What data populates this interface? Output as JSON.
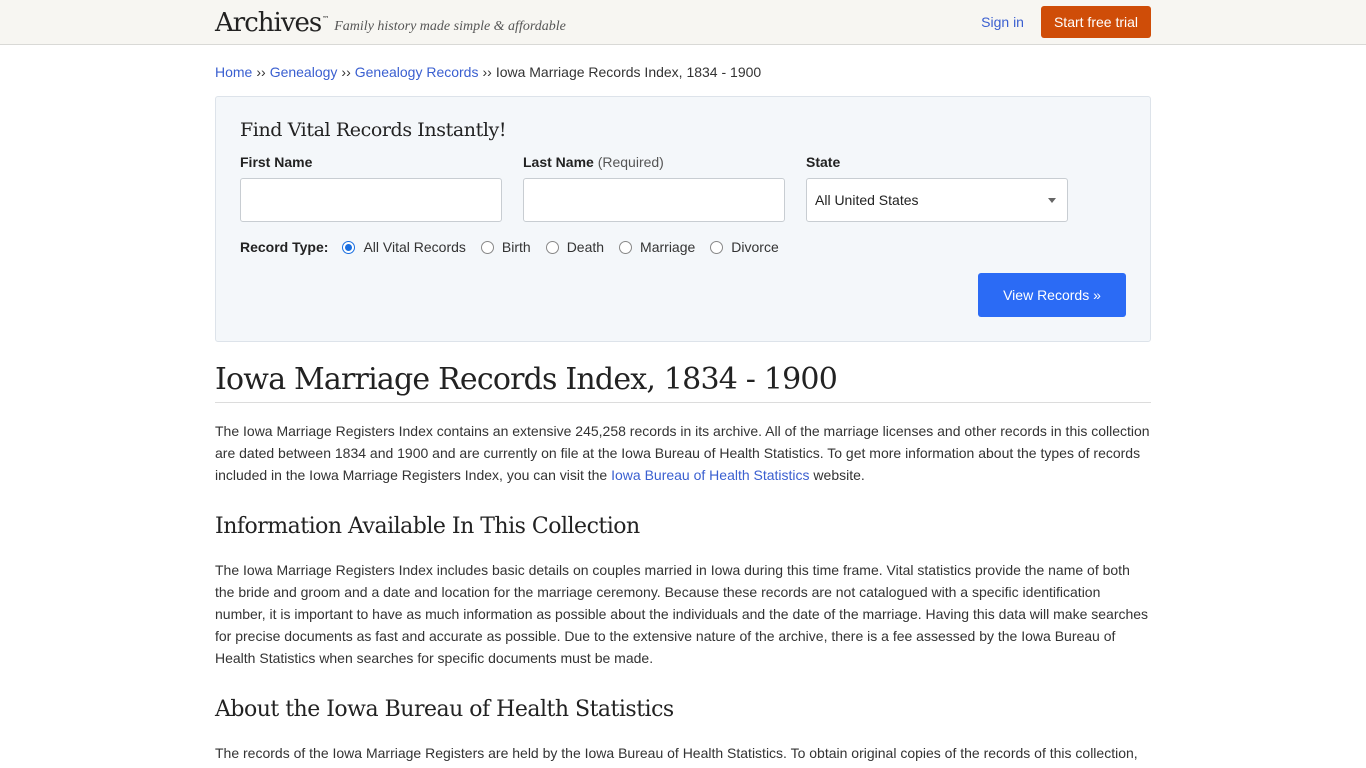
{
  "header": {
    "logo_text": "Archives",
    "logo_tm": "™",
    "tagline": "Family history made simple & affordable",
    "sign_in_label": "Sign in",
    "trial_button_label": "Start free trial",
    "trial_button_color": "#cf4d08"
  },
  "breadcrumb": {
    "items": [
      {
        "label": "Home"
      },
      {
        "label": "Genealogy"
      },
      {
        "label": "Genealogy Records"
      }
    ],
    "separator": "››",
    "current": "Iowa Marriage Records Index, 1834 - 1900"
  },
  "search": {
    "title": "Find Vital Records Instantly!",
    "first_name_label": "First Name",
    "first_name_value": "",
    "last_name_label": "Last Name",
    "last_name_required": "(Required)",
    "last_name_value": "",
    "state_label": "State",
    "state_selected": "All United States",
    "record_type_label": "Record Type:",
    "record_types": [
      {
        "label": "All Vital Records",
        "checked": true
      },
      {
        "label": "Birth",
        "checked": false
      },
      {
        "label": "Death",
        "checked": false
      },
      {
        "label": "Marriage",
        "checked": false
      },
      {
        "label": "Divorce",
        "checked": false
      }
    ],
    "submit_label": "View Records »",
    "submit_color": "#2b6bf5"
  },
  "article": {
    "title": "Iowa Marriage Records Index, 1834 - 1900",
    "intro_part1": "The Iowa Marriage Registers Index contains an extensive 245,258 records in its archive. All of the marriage licenses and other records in this collection are dated between 1834 and 1900 and are currently on file at the Iowa Bureau of Health Statistics. To get more information about the types of records included in the Iowa Marriage Registers Index, you can visit the ",
    "intro_link": "Iowa Bureau of Health Statistics",
    "intro_part2": " website.",
    "section1_title": "Information Available In This Collection",
    "section1_text": "The Iowa Marriage Registers Index includes basic details on couples married in Iowa during this time frame. Vital statistics provide the name of both the bride and groom and a date and location for the marriage ceremony. Because these records are not catalogued with a specific identification number, it is important to have as much information as possible about the individuals and the date of the marriage. Having this data will make searches for precise documents as fast and accurate as possible. Due to the extensive nature of the archive, there is a fee assessed by the Iowa Bureau of Health Statistics when searches for specific documents must be made.",
    "section2_title": "About the Iowa Bureau of Health Statistics",
    "section2_text": "The records of the Iowa Marriage Registers are held by the Iowa Bureau of Health Statistics. To obtain original copies of the records of this collection,"
  }
}
